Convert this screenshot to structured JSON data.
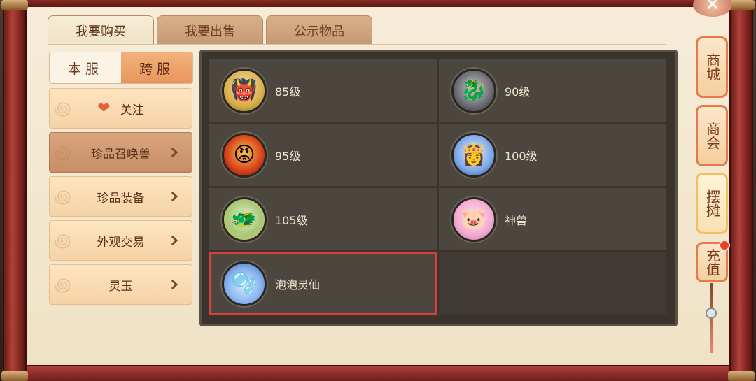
{
  "tabs": [
    {
      "label": "我要购买",
      "active": true
    },
    {
      "label": "我要出售",
      "active": false
    },
    {
      "label": "公示物品",
      "active": false
    }
  ],
  "server": {
    "local_label": "本服",
    "cross_label": "跨服",
    "selected": "cross"
  },
  "menu": [
    {
      "label": "关注",
      "icon": "heart-icon",
      "active": false
    },
    {
      "label": "珍品召唤兽",
      "icon": "chevron-right-icon",
      "active": true
    },
    {
      "label": "珍品装备",
      "icon": "chevron-right-icon",
      "active": false
    },
    {
      "label": "外观交易",
      "icon": "chevron-right-icon",
      "active": false
    },
    {
      "label": "灵玉",
      "icon": "chevron-right-icon",
      "active": false
    }
  ],
  "grid": [
    {
      "label": "85级",
      "avatar": "golden-hair-pet-avatar"
    },
    {
      "label": "90级",
      "avatar": "grey-dragon-pet-avatar"
    },
    {
      "label": "95级",
      "avatar": "fire-demon-pet-avatar"
    },
    {
      "label": "100级",
      "avatar": "blue-maiden-pet-avatar"
    },
    {
      "label": "105级",
      "avatar": "jade-dragon-pet-avatar"
    },
    {
      "label": "神兽",
      "avatar": "pink-beast-pet-avatar"
    },
    {
      "label": "泡泡灵仙",
      "avatar": "bubble-spirit-pet-avatar",
      "selected": true
    }
  ],
  "side_buttons": [
    {
      "label": "商城"
    },
    {
      "label": "商会"
    },
    {
      "label": "摆摊",
      "active": true
    },
    {
      "label": "充值",
      "badge": true
    }
  ],
  "colors": {
    "accent": "#e8955e",
    "selected_border": "#d8403a",
    "panel_bg": "#3a342d",
    "paper_bg": "#f6ecd8"
  }
}
